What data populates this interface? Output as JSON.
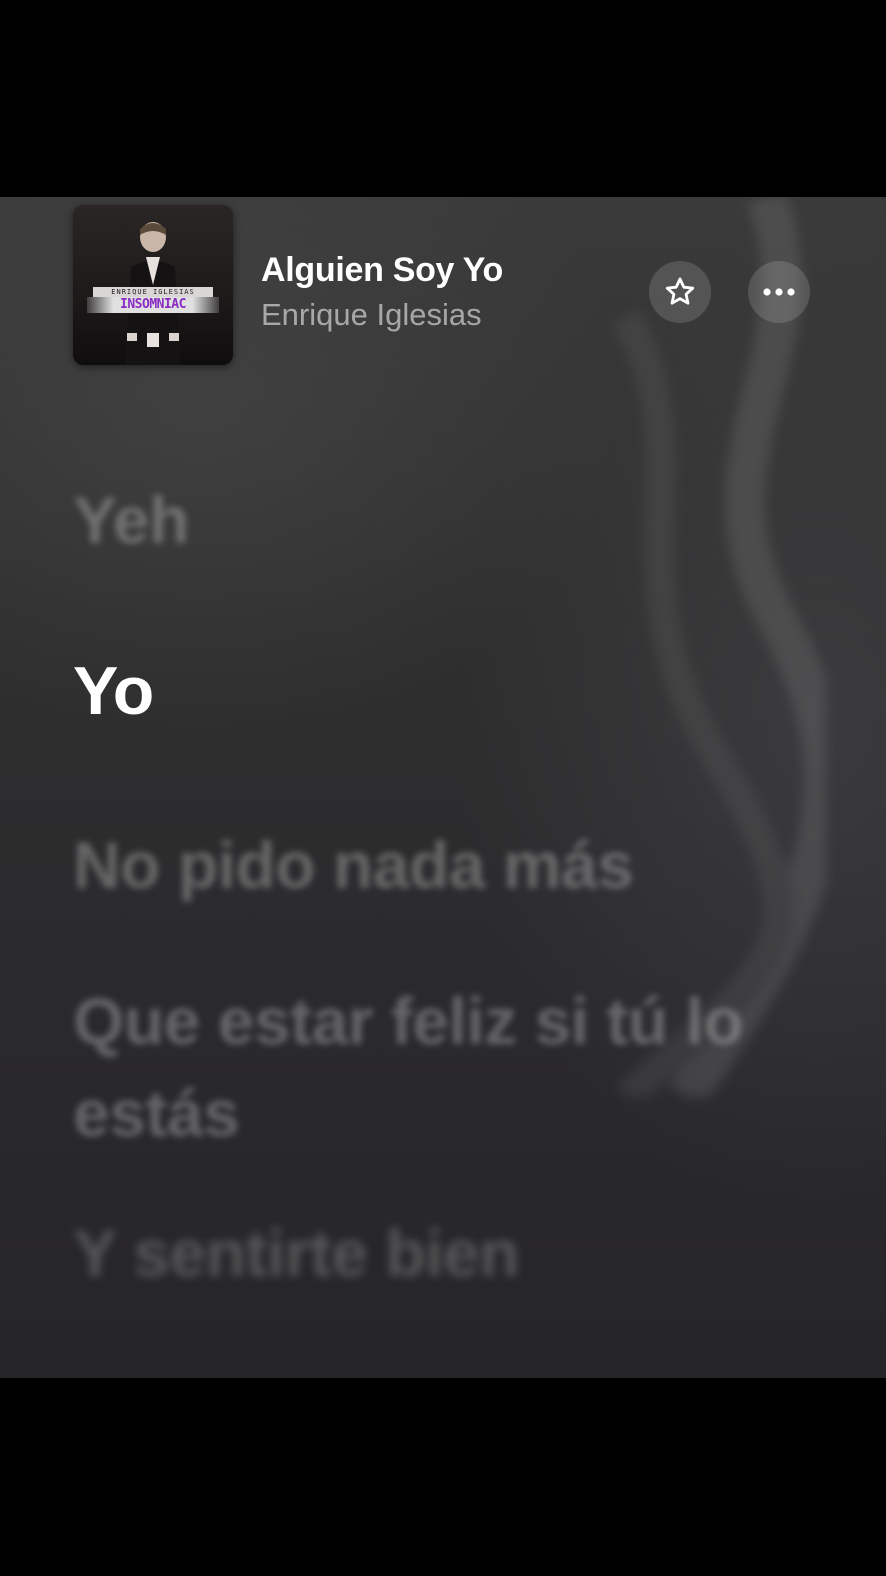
{
  "now_playing": {
    "title": "Alguien Soy Yo",
    "artist": "Enrique Iglesias",
    "artwork": {
      "banner_text": "ENRIQUE IGLESIAS",
      "album_text": "INSOMNIAC"
    },
    "favorite_icon": "star-outline-icon",
    "more_icon": "ellipsis-icon"
  },
  "lyrics": {
    "previous_faded": "Yeh",
    "current": "Yo",
    "upcoming": [
      "No pido nada más",
      "Que estar feliz si tú lo estás",
      "Y sentirte bien"
    ]
  },
  "colors": {
    "background": "#2f2f2f",
    "active_lyric": "#ffffff",
    "inactive_lyric": "rgba(255,255,255,0.28)"
  }
}
